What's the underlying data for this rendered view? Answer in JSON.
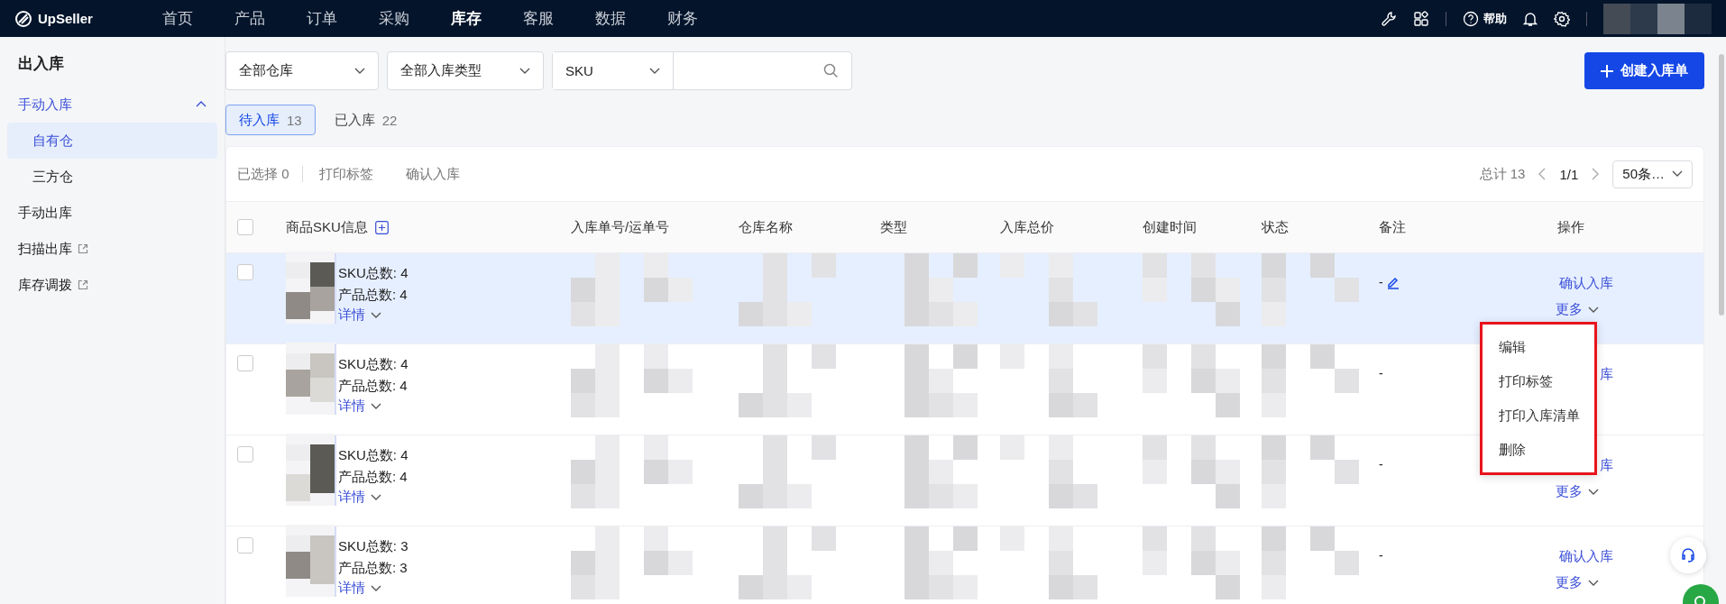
{
  "topbar": {
    "logo": "UpSeller",
    "nav": [
      {
        "label": "首页",
        "selected": false
      },
      {
        "label": "产品",
        "selected": false
      },
      {
        "label": "订单",
        "selected": false
      },
      {
        "label": "采购",
        "selected": false
      },
      {
        "label": "库存",
        "selected": true
      },
      {
        "label": "客服",
        "selected": false
      },
      {
        "label": "数据",
        "selected": false
      },
      {
        "label": "财务",
        "selected": false
      }
    ],
    "help": "帮助"
  },
  "sidebar": {
    "title": "出入库",
    "items": [
      {
        "label": "手动入库",
        "selected": false,
        "external": false,
        "expanded": true,
        "children": [
          {
            "label": "自有仓",
            "selected": true,
            "external": false
          },
          {
            "label": "三方仓",
            "selected": false,
            "external": false
          }
        ]
      },
      {
        "label": "手动出库",
        "selected": false,
        "external": false
      },
      {
        "label": "扫描出库",
        "selected": false,
        "external": true
      },
      {
        "label": "库存调拨",
        "selected": false,
        "external": true
      }
    ]
  },
  "filters": [
    {
      "kind": "select",
      "value": "全部仓库"
    },
    {
      "kind": "select",
      "value": "全部入库类型"
    },
    {
      "kind": "search",
      "value": "SKU"
    }
  ],
  "create_button": "创建入库单",
  "status_tabs": [
    {
      "label": "待入库",
      "count": "13",
      "selected": true
    },
    {
      "label": "已入库",
      "count": "22",
      "selected": false
    }
  ],
  "toolbar": {
    "selected_count": "已选择 0",
    "actions": [
      "打印标签",
      "确认入库"
    ],
    "total": "总计 13",
    "page": "1/1",
    "page_size": "50条…"
  },
  "table": {
    "all_checked": false,
    "columns": [
      "商品SKU信息",
      "入库单号/运单号",
      "仓库名称",
      "类型",
      "入库总价",
      "创建时间",
      "状态",
      "备注",
      "操作"
    ],
    "rows": [
      {
        "checked": false,
        "highlighted": true,
        "sku_count": "SKU总数: 4",
        "product_count": "产品总数: 4",
        "details": "详情",
        "remark": "-",
        "remark_editable": true,
        "confirm": "确认入库",
        "more": "更多"
      },
      {
        "checked": false,
        "highlighted": false,
        "sku_count": "SKU总数: 4",
        "product_count": "产品总数: 4",
        "details": "详情",
        "remark": "-",
        "remark_editable": false,
        "confirm": "库"
      },
      {
        "checked": false,
        "highlighted": false,
        "sku_count": "SKU总数: 4",
        "product_count": "产品总数: 4",
        "details": "详情",
        "remark": "-",
        "remark_editable": false,
        "confirm": "库",
        "more": "更多"
      },
      {
        "checked": false,
        "highlighted": false,
        "sku_count": "SKU总数: 3",
        "product_count": "产品总数: 3",
        "details": "详情",
        "remark": "-",
        "remark_editable": false,
        "confirm": "确认入库",
        "more": "更多"
      }
    ]
  },
  "more_menu": {
    "items": [
      "编辑",
      "打印标签",
      "打印入库清单",
      "删除"
    ]
  }
}
